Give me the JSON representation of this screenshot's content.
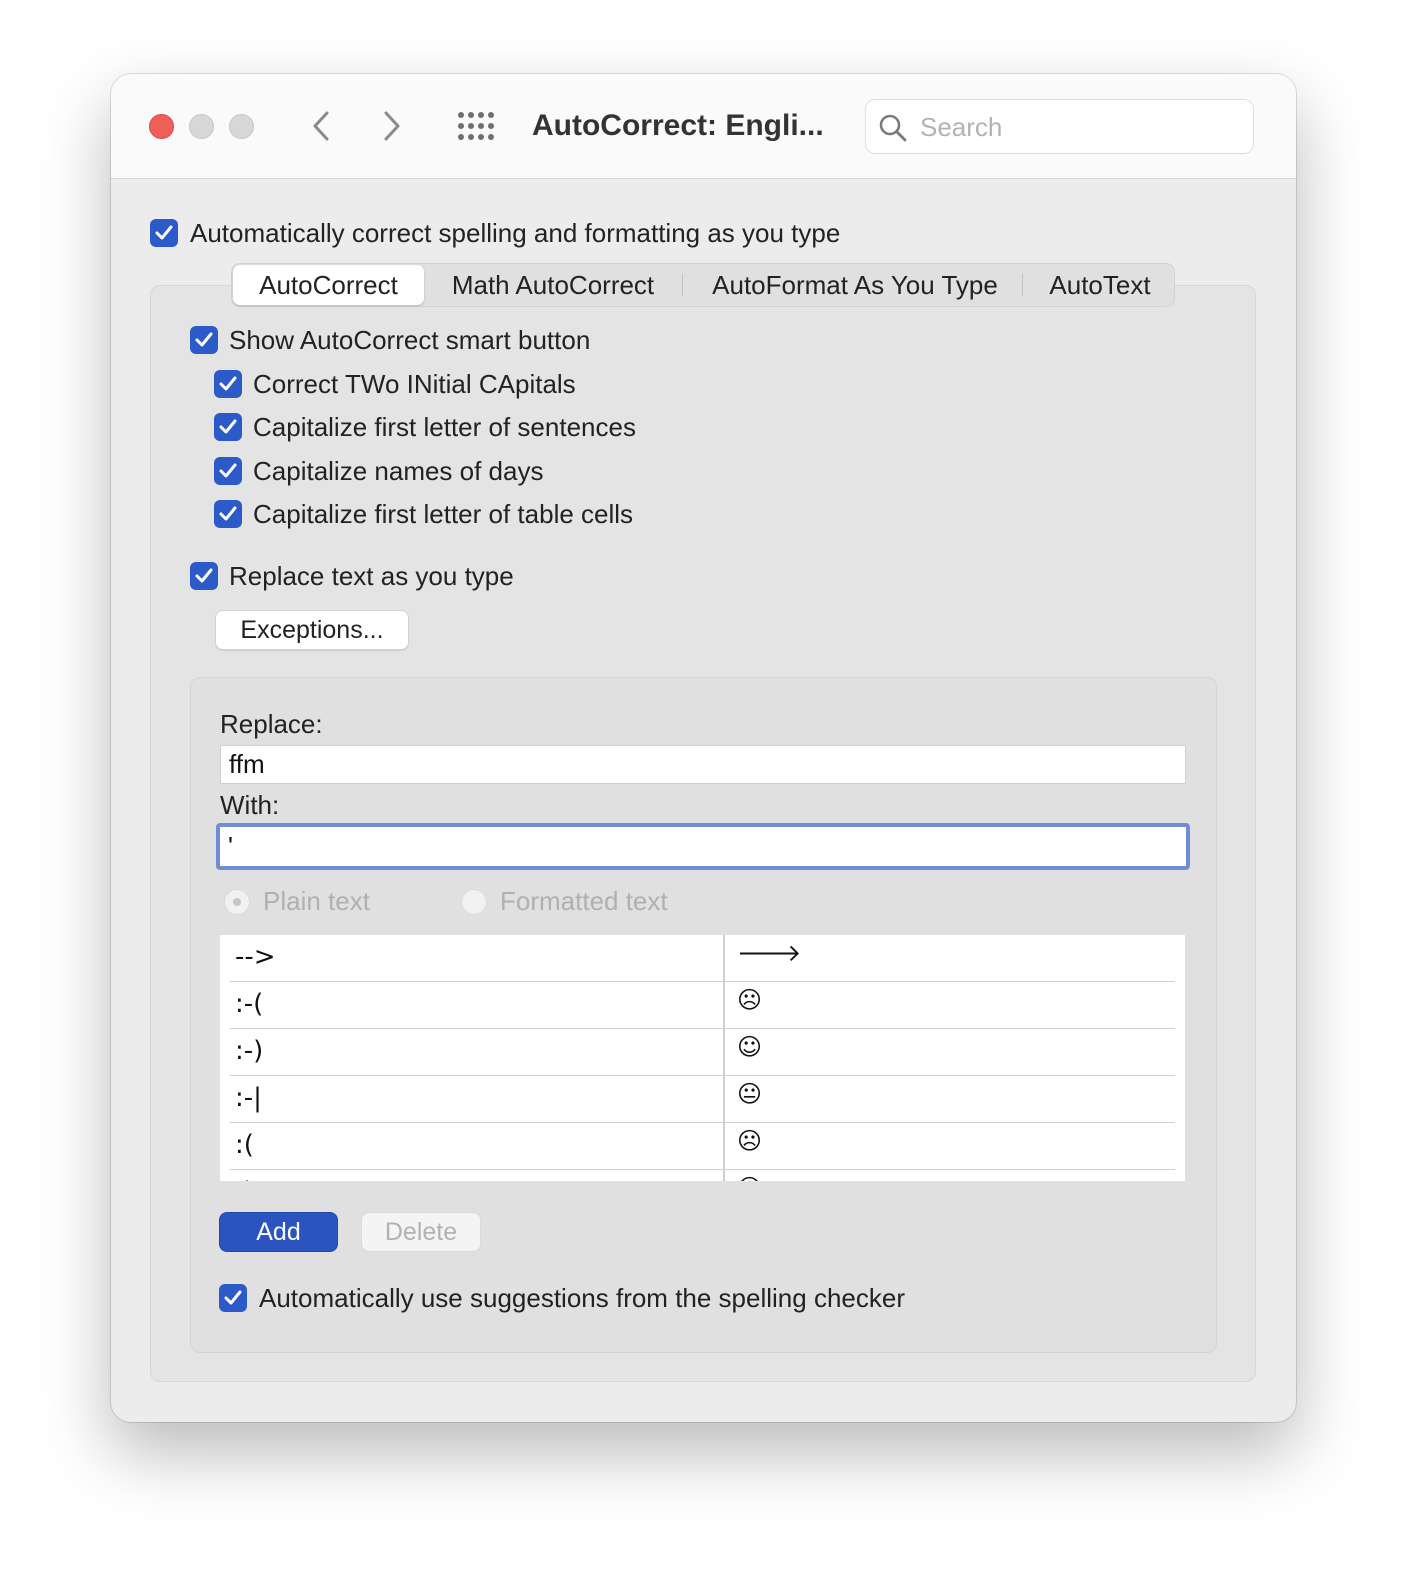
{
  "window": {
    "title": "AutoCorrect: Engli...",
    "search_placeholder": "Search"
  },
  "main_option": {
    "label": "Automatically correct spelling and formatting as you type",
    "checked": true
  },
  "tabs": [
    {
      "label": "AutoCorrect",
      "active": true
    },
    {
      "label": "Math AutoCorrect",
      "active": false
    },
    {
      "label": "AutoFormat As You Type",
      "active": false
    },
    {
      "label": "AutoText",
      "active": false
    }
  ],
  "options": [
    {
      "label": "Show AutoCorrect smart button",
      "checked": true
    },
    {
      "label": "Correct TWo INitial CApitals",
      "checked": true
    },
    {
      "label": "Capitalize first letter of sentences",
      "checked": true
    },
    {
      "label": "Capitalize names of days",
      "checked": true
    },
    {
      "label": "Capitalize first letter of table cells",
      "checked": true
    },
    {
      "label": "Replace text as you type",
      "checked": true
    }
  ],
  "exceptions_button": "Exceptions...",
  "replace": {
    "label": "Replace:",
    "value": "ffm"
  },
  "with": {
    "label": "With:",
    "value": "'"
  },
  "format_options": [
    {
      "label": "Plain text",
      "selected": true,
      "enabled": false
    },
    {
      "label": "Formatted text",
      "selected": false,
      "enabled": false
    }
  ],
  "entries": [
    {
      "replace": "-->",
      "with": "🡒"
    },
    {
      "replace": ":-(",
      "with": "☹"
    },
    {
      "replace": ":-)",
      "with": "☺"
    },
    {
      "replace": ":-|",
      "with": "😐"
    },
    {
      "replace": ":(",
      "with": "☹"
    },
    {
      "replace": ":)",
      "with": "☺"
    }
  ],
  "buttons": {
    "add": "Add",
    "delete": "Delete"
  },
  "spelling_option": {
    "label": "Automatically use suggestions from the spelling checker",
    "checked": true
  },
  "colors": {
    "accent": "#2d5ac9",
    "close": "#ee5f57",
    "focus_ring": "#6f8ed3"
  }
}
